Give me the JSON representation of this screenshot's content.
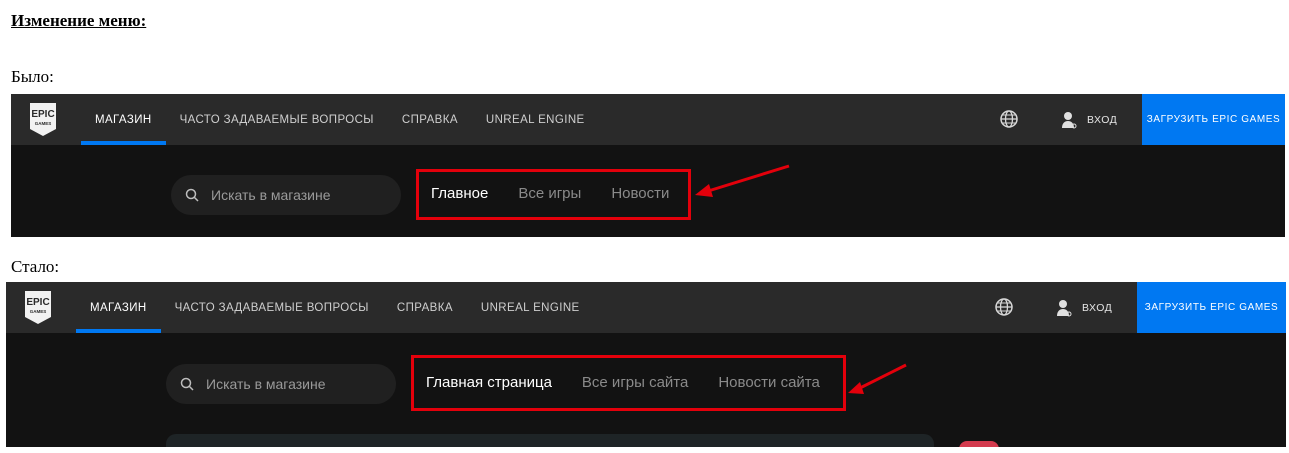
{
  "doc": {
    "heading": "Изменение меню:",
    "before_label": "Было:",
    "after_label": "Стало:"
  },
  "logo_text": {
    "line1": "EPIC",
    "line2": "GAMES"
  },
  "header": {
    "nav": [
      "МАГАЗИН",
      "ЧАСТО ЗАДАВАЕМЫЕ ВОПРОСЫ",
      "СПРАВКА",
      "UNREAL ENGINE"
    ],
    "signin": "ВХОД",
    "download": "ЗАГРУЗИТЬ EPIC GAMES"
  },
  "search": {
    "placeholder": "Искать в магазине"
  },
  "before": {
    "tabs": [
      "Главное",
      "Все игры",
      "Новости"
    ]
  },
  "after": {
    "tabs": [
      "Главная страница",
      "Все игры сайта",
      "Новости сайта"
    ]
  },
  "colors": {
    "accent": "#0078f2",
    "highlight": "#e3000b",
    "header_bg": "#2a2a2a",
    "page_bg": "#121212"
  },
  "icons": [
    "epic-games-logo",
    "globe-icon",
    "user-icon",
    "search-icon",
    "red-arrow"
  ]
}
